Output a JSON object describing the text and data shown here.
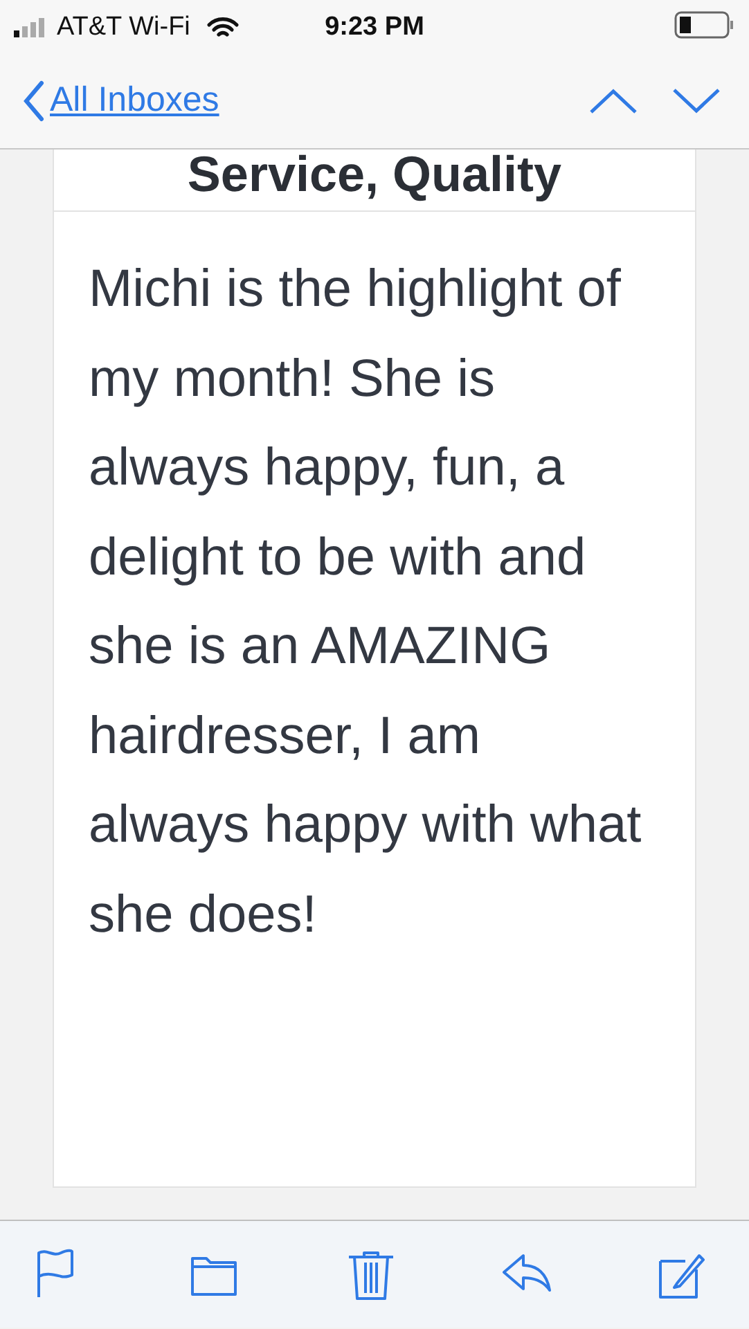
{
  "status_bar": {
    "carrier": "AT&T Wi-Fi",
    "time": "9:23 PM"
  },
  "nav": {
    "back_label": "All Inboxes"
  },
  "message": {
    "heading": "Service, Quality",
    "body": "Michi is the highlight of my month! She is always happy, fun, a delight to be with and she is an AMAZING hairdresser, I am always happy with what she does!"
  },
  "toolbar": [
    {
      "kind": "flag"
    },
    {
      "kind": "folder"
    },
    {
      "kind": "trash"
    },
    {
      "kind": "reply"
    },
    {
      "kind": "compose"
    }
  ]
}
